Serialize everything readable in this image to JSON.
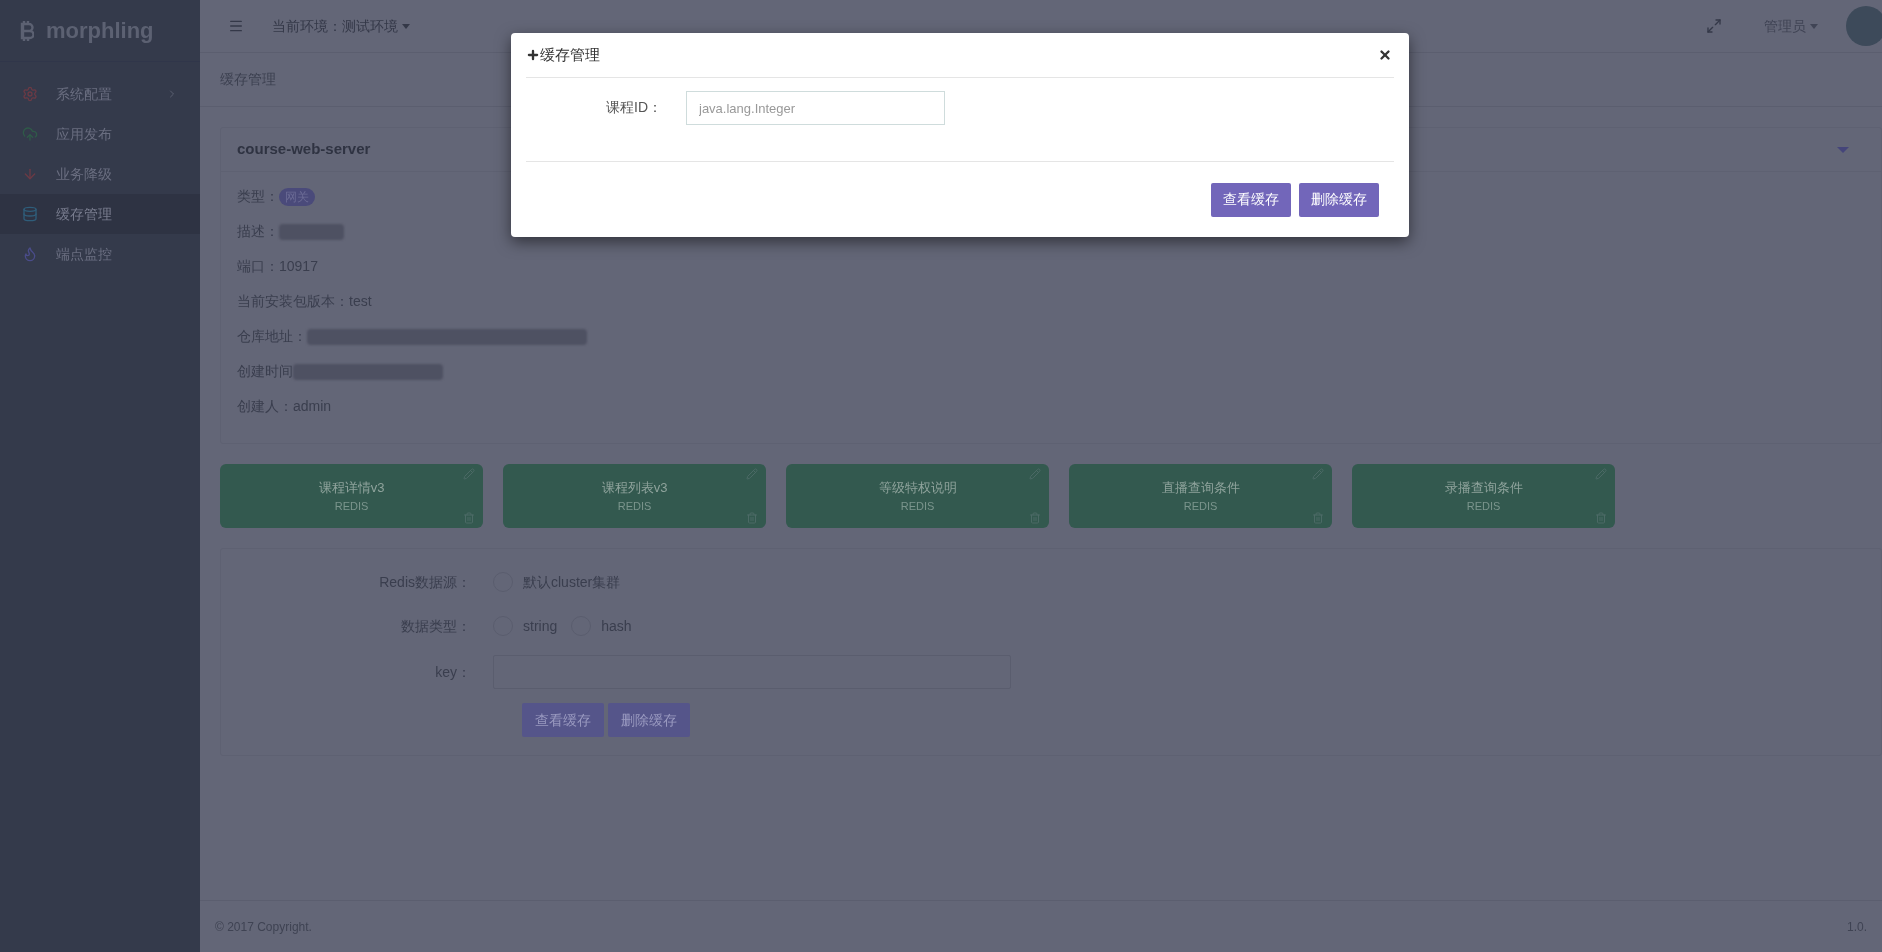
{
  "brand": {
    "name": "morphling"
  },
  "sidebar": {
    "items": [
      {
        "label": "系统配置",
        "kind": "gear",
        "selected": false,
        "has_arrow": true
      },
      {
        "label": "应用发布",
        "kind": "cloud",
        "selected": false,
        "has_arrow": false
      },
      {
        "label": "业务降级",
        "kind": "arrow",
        "selected": false,
        "has_arrow": false
      },
      {
        "label": "缓存管理",
        "kind": "database",
        "selected": true,
        "has_arrow": false
      },
      {
        "label": "端点监控",
        "kind": "fire",
        "selected": false,
        "has_arrow": false
      }
    ]
  },
  "header": {
    "environment": "当前环境：测试环境",
    "user": "管理员"
  },
  "breadcrumb": "缓存管理",
  "server": {
    "title": "course-web-server",
    "fields": [
      {
        "label": "类型：",
        "kind": "badge",
        "value": "网关"
      },
      {
        "label": "描述：",
        "kind": "redacted"
      },
      {
        "label": "端口：",
        "kind": "text",
        "value": "10917"
      },
      {
        "label": "当前安装包版本：",
        "kind": "text",
        "value": "test"
      },
      {
        "label": "仓库地址：",
        "kind": "redacted"
      },
      {
        "label": "创建时间",
        "kind": "redacted"
      },
      {
        "label": "创建人：",
        "kind": "text",
        "value": "admin"
      }
    ]
  },
  "cards": [
    {
      "title": "课程详情v3",
      "subtitle": "REDIS"
    },
    {
      "title": "课程列表v3",
      "subtitle": "REDIS"
    },
    {
      "title": "等级特权说明",
      "subtitle": "REDIS"
    },
    {
      "title": "直播查询条件",
      "subtitle": "REDIS"
    },
    {
      "title": "录播查询条件",
      "subtitle": "REDIS"
    }
  ],
  "form": {
    "rows": [
      {
        "label": "Redis数据源：",
        "kind": "radio",
        "options": [
          {
            "label": "默认cluster集群",
            "selected": false
          }
        ]
      },
      {
        "label": "数据类型：",
        "kind": "radio",
        "options": [
          {
            "label": "string",
            "selected": false
          },
          {
            "label": "hash",
            "selected": false
          }
        ]
      },
      {
        "label": "key：",
        "kind": "input"
      }
    ],
    "buttons": [
      "查看缓存",
      "删除缓存"
    ]
  },
  "footer": {
    "copyright": "© 2017 Copyright.",
    "version": "1.0."
  },
  "modal": {
    "title": "缓存管理",
    "field": {
      "label": "课程ID：",
      "placeholder": "java.lang.Integer"
    },
    "buttons": [
      "查看缓存",
      "删除缓存"
    ]
  }
}
